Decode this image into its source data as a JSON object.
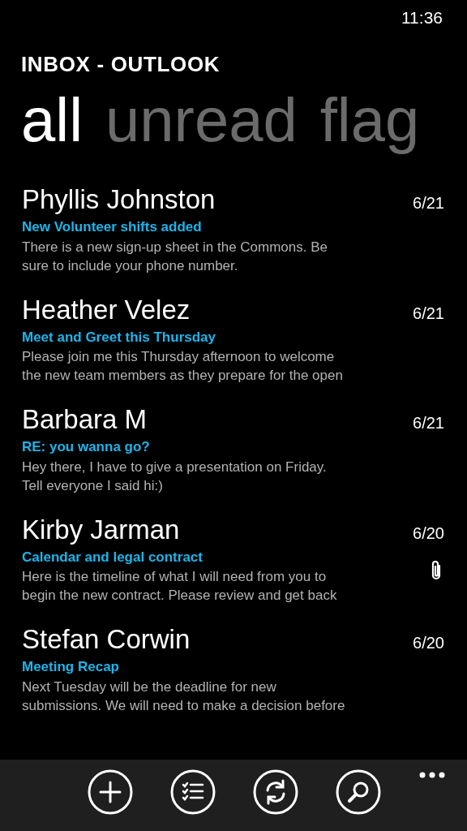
{
  "status_bar": {
    "time": "11:36"
  },
  "title": "INBOX - OUTLOOK",
  "pivots": [
    {
      "label": "all",
      "selected": true
    },
    {
      "label": "unread",
      "selected": false
    },
    {
      "label": "flag",
      "selected": false
    }
  ],
  "emails": [
    {
      "sender": "Phyllis Johnston",
      "date": "6/21",
      "subject": "New Volunteer shifts added",
      "preview": [
        "There is a new sign-up sheet in the Commons. Be",
        "sure to include your phone number."
      ],
      "attachment": false
    },
    {
      "sender": "Heather Velez",
      "date": "6/21",
      "subject": "Meet and Greet this Thursday",
      "preview": [
        "Please join me this Thursday afternoon to welcome",
        "the new team members as they prepare for the open"
      ],
      "attachment": false
    },
    {
      "sender": "Barbara M",
      "date": "6/21",
      "subject": "RE: you wanna go?",
      "preview": [
        "Hey there, I have to give a presentation on Friday.",
        "Tell everyone I said hi:)"
      ],
      "attachment": false
    },
    {
      "sender": "Kirby Jarman",
      "date": "6/20",
      "subject": "Calendar and legal contract",
      "preview": [
        "Here is the timeline of what I will need from you to",
        "begin the new contract. Please review and get back"
      ],
      "attachment": true
    },
    {
      "sender": "Stefan Corwin",
      "date": "6/20",
      "subject": "Meeting Recap",
      "preview": [
        "Next Tuesday will be the deadline for new",
        "submissions. We will need to make a decision before"
      ],
      "attachment": false
    }
  ],
  "app_bar": [
    {
      "kind": "new"
    },
    {
      "kind": "select"
    },
    {
      "kind": "sync"
    },
    {
      "kind": "search"
    }
  ]
}
